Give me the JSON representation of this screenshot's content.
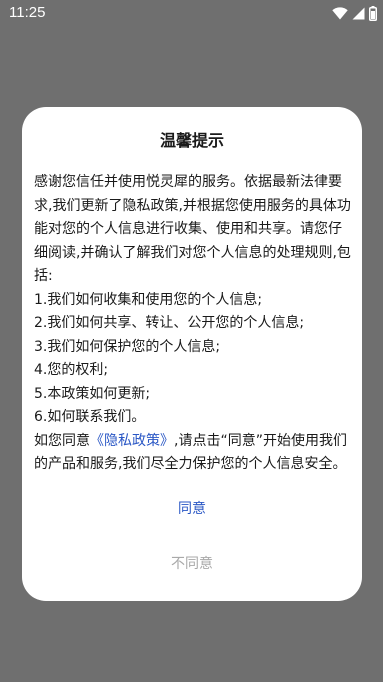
{
  "status_bar": {
    "time": "11:25",
    "icons": [
      "wifi-icon",
      "cellular-signal-icon",
      "battery-icon"
    ]
  },
  "dialog": {
    "title": "温馨提示",
    "intro": "感谢您信任并使用悦灵犀的服务。依据最新法律要求,我们更新了隐私政策,并根据您使用服务的具体功能对您的个人信息进行收集、使用和共享。请您仔细阅读,并确认了解我们对您个人信息的处理规则,包括:",
    "items": [
      "1.我们如何收集和使用您的个人信息;",
      "2.我们如何共享、转让、公开您的个人信息;",
      "3.我们如何保护您的个人信息;",
      "4.您的权利;",
      "5.本政策如何更新;",
      "6.如何联系我们。"
    ],
    "closing_prefix": "如您同意",
    "policy_link": "《隐私政策》",
    "closing_suffix": ",请点击“同意”开始使用我们的产品和服务,我们尽全力保护您的个人信息安全。",
    "agree_label": "同意",
    "disagree_label": "不同意"
  },
  "colors": {
    "overlay": "#6f6f6f",
    "link": "#2a57c5",
    "muted": "#a9a9a9",
    "text": "#1a1a1a"
  }
}
